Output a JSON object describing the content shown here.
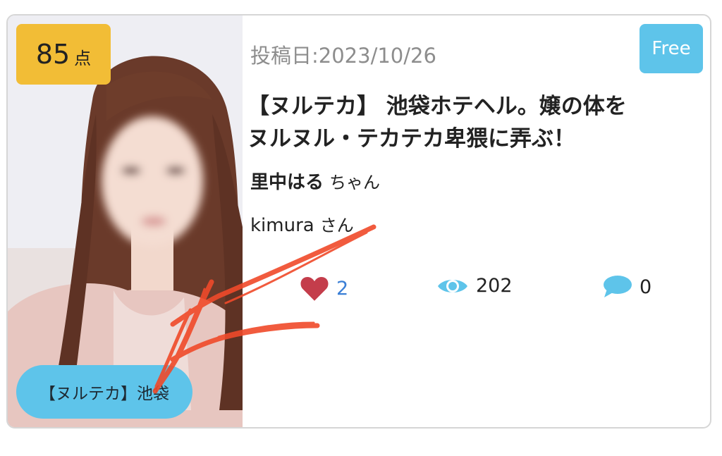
{
  "card": {
    "score": {
      "value": "85",
      "unit": "点"
    },
    "area_tag": "【ヌルテカ】池袋",
    "price_badge": "Free",
    "posted_date": "投稿日:2023/10/26",
    "title_line1": "【ヌルテカ】 池袋ホテヘル。嬢の体を",
    "title_line2": "ヌルヌル・テカテカ卑猥に弄ぶ！",
    "girl_name": "里中はる",
    "girl_suffix": "ちゃん",
    "reviewer_name": "kimura",
    "reviewer_suffix": "さん",
    "stats": {
      "likes": "2",
      "views": "202",
      "comments": "0"
    },
    "icons": {
      "likes": "heart-icon",
      "views": "eye-icon",
      "comments": "speech-bubble-icon"
    },
    "colors": {
      "score_badge": "#f2bd36",
      "accent_blue": "#5ec4ea",
      "heart": "#c43d4b",
      "like_count": "#3b7fd6",
      "scribble": "#f04a2a"
    }
  }
}
